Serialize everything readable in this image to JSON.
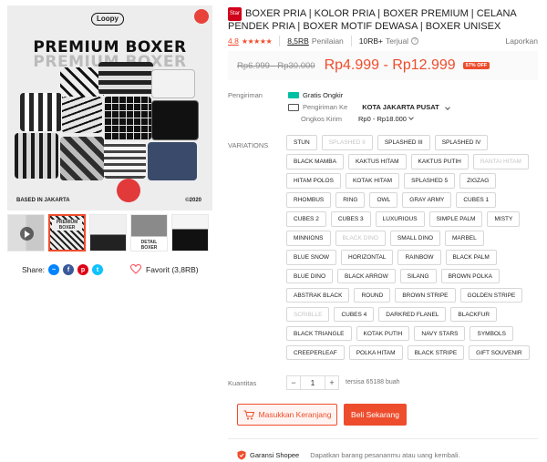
{
  "gallery": {
    "brand_logo": "Loopy",
    "headline": "PREMIUM BOXER",
    "headline_echo": "PREMIUM BOXER",
    "footer_left": "BASED IN JAKARTA",
    "footer_right": "©2020",
    "thumbnails": [
      {
        "label": "",
        "video": true
      },
      {
        "label": "PREMIUM BOXER",
        "video": false
      },
      {
        "label": "",
        "video": false
      },
      {
        "label": "DETAIL BOXER",
        "video": false
      },
      {
        "label": "",
        "video": false
      }
    ]
  },
  "share": {
    "label": "Share:",
    "icons": [
      "messenger-icon",
      "facebook-icon",
      "pinterest-icon",
      "twitter-icon"
    ]
  },
  "favorite": {
    "label": "Favorit (3,8RB)"
  },
  "product": {
    "badge": "Star",
    "title": "BOXER PRIA | KOLOR PRIA | BOXER PREMIUM | CELANA PENDEK PRIA | BOXER MOTIF DEWASA | BOXER UNISEX"
  },
  "ratings": {
    "score": "4.8",
    "stars": "★★★★★",
    "count": "8,5RB",
    "count_label": "Penilaian",
    "sold": "10RB+",
    "sold_label": "Terjual",
    "help": "?",
    "report": "Laporkan"
  },
  "price": {
    "old": "Rp6.999 - Rp30.000",
    "current": "Rp4.999 - Rp12.999",
    "discount": "57% OFF"
  },
  "shipping": {
    "label": "Pengiriman",
    "free": "Gratis Ongkir",
    "to_label": "Pengiriman Ke",
    "to_value": "KOTA JAKARTA PUSAT",
    "cost_label": "Ongkos Kirim",
    "cost_value": "Rp0 - Rp18.000"
  },
  "variations": {
    "label": "VARIATIONS",
    "options": [
      {
        "name": "STUN",
        "available": true
      },
      {
        "name": "SPLASHED II",
        "available": false
      },
      {
        "name": "SPLASHED III",
        "available": true
      },
      {
        "name": "SPLASHED IV",
        "available": true
      },
      {
        "name": "BLACK MAMBA",
        "available": true
      },
      {
        "name": "KAKTUS HITAM",
        "available": true
      },
      {
        "name": "KAKTUS PUTIH",
        "available": true
      },
      {
        "name": "RANTAI HITAM",
        "available": false
      },
      {
        "name": "HITAM POLOS",
        "available": true
      },
      {
        "name": "KOTAK HITAM",
        "available": true
      },
      {
        "name": "SPLASHED 5",
        "available": true
      },
      {
        "name": "ZIGZAG",
        "available": true
      },
      {
        "name": "RHOMBUS",
        "available": true
      },
      {
        "name": "RING",
        "available": true
      },
      {
        "name": "OWL",
        "available": true
      },
      {
        "name": "GRAY ARMY",
        "available": true
      },
      {
        "name": "CUBES 1",
        "available": true
      },
      {
        "name": "CUBES 2",
        "available": true
      },
      {
        "name": "CUBES 3",
        "available": true
      },
      {
        "name": "LUXURIOUS",
        "available": true
      },
      {
        "name": "SIMPLE PALM",
        "available": true
      },
      {
        "name": "MISTY",
        "available": true
      },
      {
        "name": "MINNIONS",
        "available": true
      },
      {
        "name": "BLACK DINO",
        "available": false
      },
      {
        "name": "SMALL DINO",
        "available": true
      },
      {
        "name": "MARBEL",
        "available": true
      },
      {
        "name": "BLUE SNOW",
        "available": true
      },
      {
        "name": "HORIZONTAL",
        "available": true
      },
      {
        "name": "RAINBOW",
        "available": true
      },
      {
        "name": "BLACK PALM",
        "available": true
      },
      {
        "name": "BLUE DINO",
        "available": true
      },
      {
        "name": "BLACK ARROW",
        "available": true
      },
      {
        "name": "SILANG",
        "available": true
      },
      {
        "name": "BROWN POLKA",
        "available": true
      },
      {
        "name": "ABSTRAK BLACK",
        "available": true
      },
      {
        "name": "ROUND",
        "available": true
      },
      {
        "name": "BROWN STRIPE",
        "available": true
      },
      {
        "name": "GOLDEN STRIPE",
        "available": true
      },
      {
        "name": "SCRIBLLE",
        "available": false
      },
      {
        "name": "CUBES 4",
        "available": true
      },
      {
        "name": "DARKRED FLANEL",
        "available": true
      },
      {
        "name": "BLACKFUR",
        "available": true
      },
      {
        "name": "BLACK TRIANGLE",
        "available": true
      },
      {
        "name": "KOTAK PUTIH",
        "available": true
      },
      {
        "name": "NAVY STARS",
        "available": true
      },
      {
        "name": "SYMBOLS",
        "available": true
      },
      {
        "name": "CREEPERLEAF",
        "available": true
      },
      {
        "name": "POLKA HITAM",
        "available": true
      },
      {
        "name": "BLACK STRIPE",
        "available": true
      },
      {
        "name": "GIFT SOUVENIR",
        "available": true
      }
    ]
  },
  "quantity": {
    "label": "Kuantitas",
    "minus": "−",
    "value": "1",
    "plus": "+",
    "stock": "tersisa 65188 buah"
  },
  "actions": {
    "add_to_cart": "Masukkan Keranjang",
    "buy_now": "Beli Sekarang"
  },
  "guarantee": {
    "title": "Garansi Shopee",
    "desc": "Dapatkan barang pesananmu atau uang kembali."
  },
  "colors": {
    "accent": "#ee4d2d",
    "free_shipping": "#00bfa5"
  }
}
